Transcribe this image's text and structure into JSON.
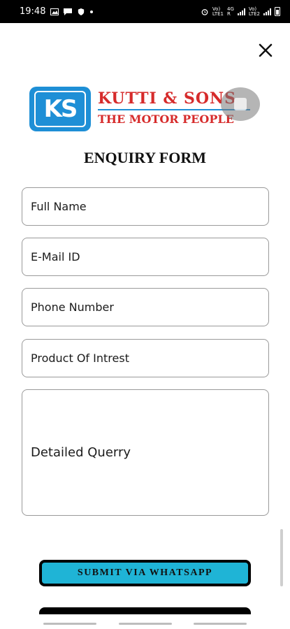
{
  "status_bar": {
    "time": "19:48",
    "net1": "Vo)",
    "net1b": "LTE1",
    "net2": "4G",
    "net2b": "R",
    "net3": "Vo)",
    "net3b": "LTE2"
  },
  "logo": {
    "mark": "KS",
    "title": "KUTTI & SONS",
    "subtitle": "THE MOTOR PEOPLE"
  },
  "form": {
    "title": "ENQUIRY FORM",
    "full_name_placeholder": "Full Name",
    "email_placeholder": "E-Mail ID",
    "phone_placeholder": "Phone Number",
    "product_placeholder": "Product Of Intrest",
    "query_placeholder": "Detailed Querry",
    "submit_label": "SUBMIT VIA WHATSAPP"
  },
  "colors": {
    "brand_blue": "#1e8fd6",
    "brand_red": "#d62b2b",
    "submit_bg": "#1fb4d6"
  },
  "icons": {
    "close": "close-icon",
    "gallery": "image-icon",
    "message": "chat-icon",
    "shield": "shield-icon"
  }
}
